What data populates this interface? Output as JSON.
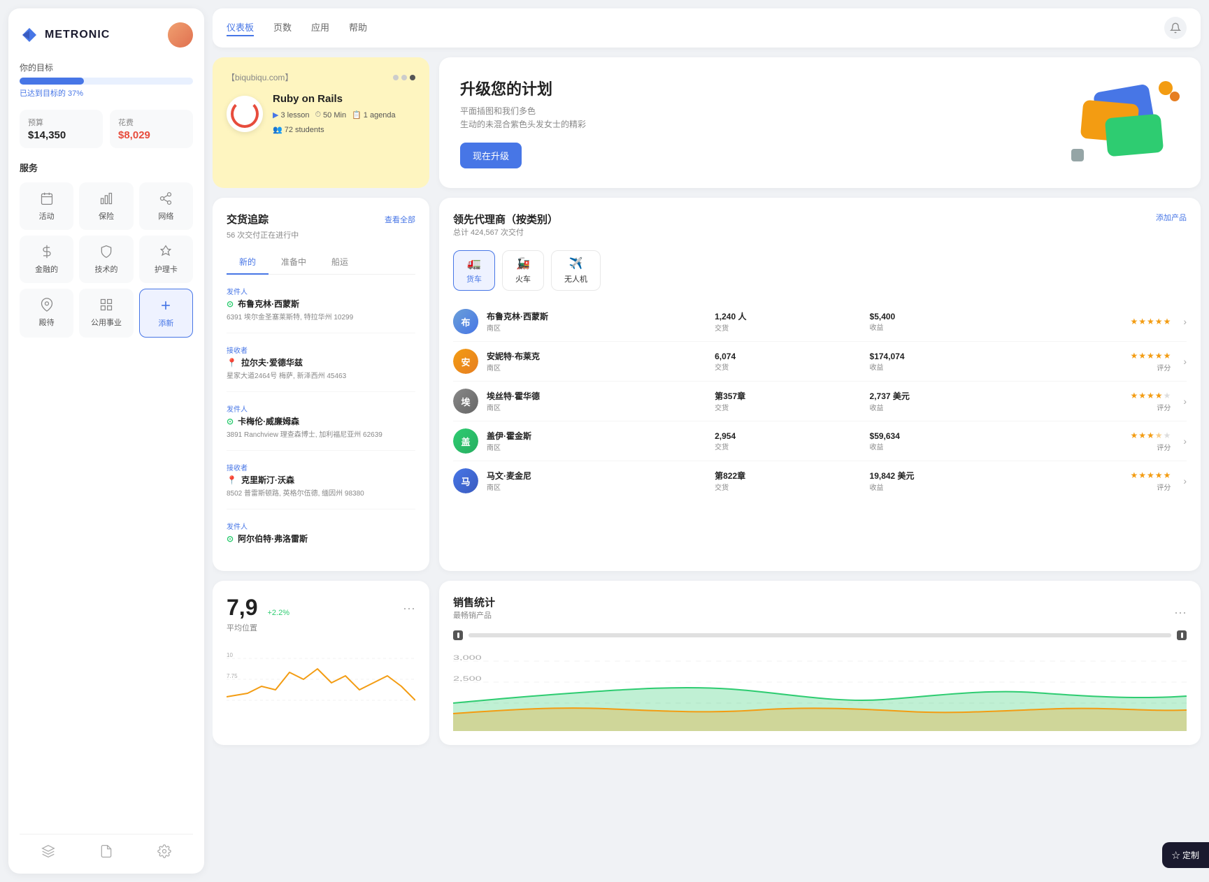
{
  "app": {
    "name": "METRONIC"
  },
  "sidebar": {
    "goal_label": "你的目标",
    "goal_pct": "已达到目标的 37%",
    "budget_label": "预算",
    "budget_value": "$14,350",
    "expense_label": "花费",
    "expense_value": "$8,029",
    "services_title": "服务",
    "services": [
      {
        "id": "activity",
        "label": "活动",
        "icon": "calendar"
      },
      {
        "id": "insurance",
        "label": "保险",
        "icon": "bar-chart"
      },
      {
        "id": "network",
        "label": "网络",
        "icon": "share"
      },
      {
        "id": "finance",
        "label": "金融的",
        "icon": "dollar"
      },
      {
        "id": "tech",
        "label": "技术的",
        "icon": "shield"
      },
      {
        "id": "nursing",
        "label": "护理卡",
        "icon": "rocket"
      },
      {
        "id": "reception",
        "label": "殿待",
        "icon": "map-pin"
      },
      {
        "id": "public",
        "label": "公用事业",
        "icon": "grid"
      },
      {
        "id": "add",
        "label": "添新",
        "icon": "plus",
        "isAdd": true
      }
    ]
  },
  "topnav": {
    "links": [
      {
        "id": "dashboard",
        "label": "仪表板",
        "active": true
      },
      {
        "id": "pages",
        "label": "页数"
      },
      {
        "id": "apps",
        "label": "应用"
      },
      {
        "id": "help",
        "label": "帮助"
      }
    ]
  },
  "course_card": {
    "url": "【biqubiqu.com】",
    "title": "Ruby on Rails",
    "lessons": "3 lesson",
    "duration": "50 Min",
    "agenda": "1 agenda",
    "students": "72 students"
  },
  "upgrade_card": {
    "title": "升级您的计划",
    "desc_line1": "平面插图和我们多色",
    "desc_line2": "生动的未混合紫色头发女士的精彩",
    "btn_label": "现在升级"
  },
  "tracking": {
    "title": "交货追踪",
    "subtitle": "56 次交付正在进行中",
    "link": "查看全部",
    "tabs": [
      "新的",
      "准备中",
      "船运"
    ],
    "active_tab": 0,
    "items": [
      {
        "role": "发件人",
        "name": "布鲁克林·西蒙斯",
        "address": "6391 埃尔金圣塞莱斯特, 特拉华州 10299",
        "type": "sender"
      },
      {
        "role": "接收者",
        "name": "拉尔夫·爱德华兹",
        "address": "星家大道2464号 梅萨, 新泽西州 45463",
        "type": "receiver"
      },
      {
        "role": "发件人",
        "name": "卡梅伦·威廉姆森",
        "address": "3891 Ranchview 理查森博士, 加利福尼亚州 62639",
        "type": "sender"
      },
      {
        "role": "接收者",
        "name": "克里斯汀·沃森",
        "address": "8502 普雷斯顿路, 英格尔伍德, 缅因州 98380",
        "type": "receiver"
      },
      {
        "role": "发件人",
        "name": "阿尔伯特·弗洛雷斯",
        "address": "",
        "type": "sender"
      }
    ]
  },
  "agents": {
    "title": "领先代理商（按类别）",
    "subtitle": "总计 424,567 次交付",
    "add_btn": "添加产品",
    "categories": [
      {
        "id": "truck",
        "label": "货车",
        "active": true
      },
      {
        "id": "train",
        "label": "火车"
      },
      {
        "id": "drone",
        "label": "无人机"
      }
    ],
    "rows": [
      {
        "name": "布鲁克林·西蒙斯",
        "region": "南区",
        "transactions": "1,240 人",
        "trans_label": "交货",
        "revenue": "$5,400",
        "rev_label": "收益",
        "stars": 5,
        "rating_label": ""
      },
      {
        "name": "安妮特·布莱克",
        "region": "南区",
        "transactions": "6,074",
        "trans_label": "交货",
        "revenue": "$174,074",
        "rev_label": "收益",
        "stars": 5,
        "rating_label": "评分"
      },
      {
        "name": "埃丝特·霍华德",
        "region": "南区",
        "transactions": "第357章",
        "trans_label": "交货",
        "revenue": "2,737 美元",
        "rev_label": "收益",
        "stars": 4,
        "rating_label": "评分"
      },
      {
        "name": "盖伊·霍金斯",
        "region": "南区",
        "transactions": "2,954",
        "trans_label": "交货",
        "revenue": "$59,634",
        "rev_label": "收益",
        "stars": 3.5,
        "rating_label": "评分"
      },
      {
        "name": "马文·麦金尼",
        "region": "南区",
        "transactions": "第822章",
        "trans_label": "交货",
        "revenue": "19,842 美元",
        "rev_label": "收益",
        "stars": 5,
        "rating_label": "评分"
      }
    ]
  },
  "position": {
    "value": "7,9",
    "trend": "+2.2%",
    "label": "平均位置",
    "more": "..."
  },
  "sales": {
    "title": "销售统计",
    "subtitle": "最畅销产品",
    "more": "..."
  },
  "customize_btn": "☆ 定制"
}
